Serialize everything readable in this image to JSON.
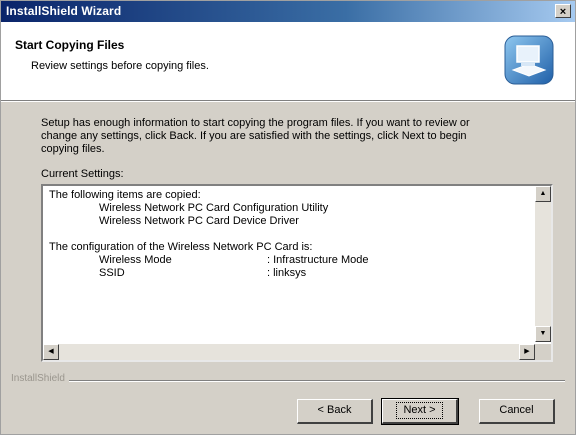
{
  "window": {
    "title": "InstallShield Wizard",
    "close_glyph": "×"
  },
  "header": {
    "title": "Start Copying Files",
    "subtitle": "Review settings before copying files.",
    "icon": "install-computer-icon"
  },
  "intro": {
    "lines": [
      "Setup has enough information to start copying the program files.  If you want to review or",
      "change any settings, click Back.  If you are satisfied with the settings, click Next to begin",
      "copying files."
    ]
  },
  "settings": {
    "label": "Current Settings:",
    "items_heading": "The following items are copied:",
    "items": [
      "Wireless Network PC Card Configuration Utility",
      "Wireless Network PC Card Device Driver"
    ],
    "config_heading": "The configuration of the Wireless Network PC Card is:",
    "config": [
      {
        "key": "Wireless Mode",
        "value": ": Infrastructure Mode"
      },
      {
        "key": "SSID",
        "value": ": linksys"
      }
    ]
  },
  "footer": {
    "brand": "InstallShield"
  },
  "buttons": {
    "back": "< Back",
    "next": "Next >",
    "cancel": "Cancel"
  },
  "colors": {
    "titlebar_start": "#0a246a",
    "titlebar_end": "#a6caf0",
    "dialog_bg": "#d4d0c8"
  }
}
